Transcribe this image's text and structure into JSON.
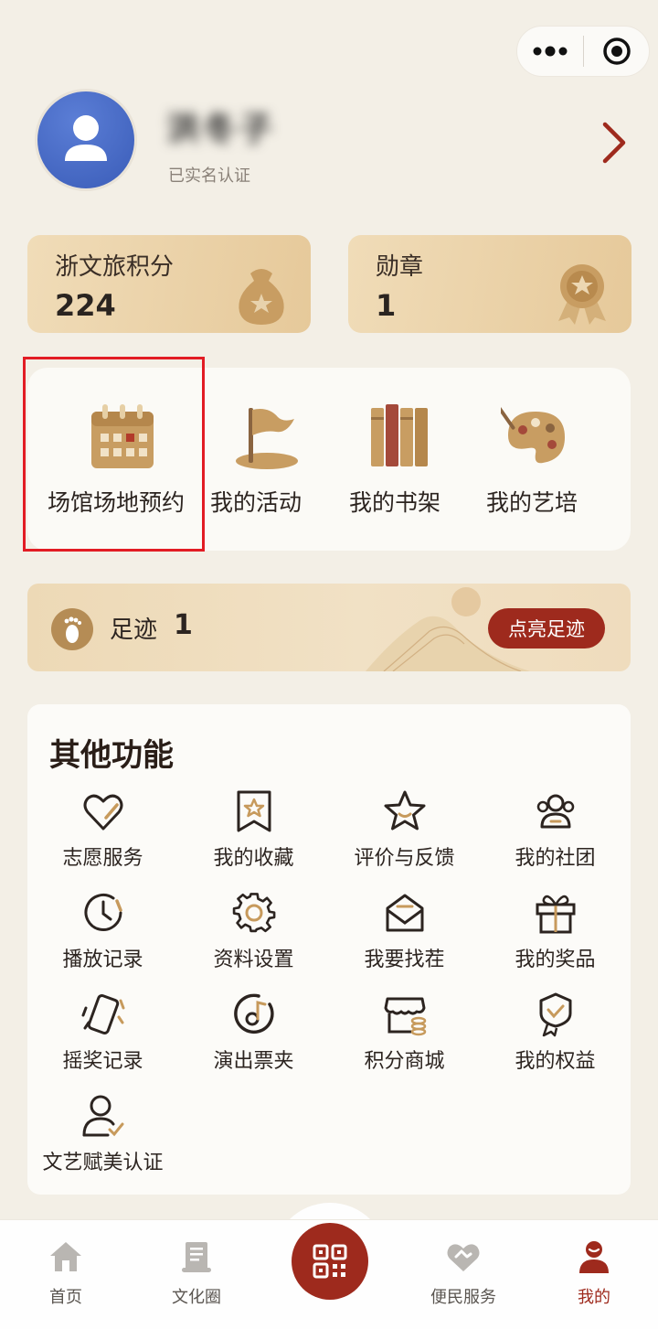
{
  "capsule": {
    "more_icon": "more-dots-icon",
    "close_icon": "target-circle-icon"
  },
  "profile": {
    "name": "洪冬子",
    "status": "已实名认证"
  },
  "stats": [
    {
      "label": "浙文旅积分",
      "value": "224",
      "icon": "money-bag-icon"
    },
    {
      "label": "勋章",
      "value": "1",
      "icon": "medal-icon"
    }
  ],
  "quick": [
    {
      "label": "场馆场地预约",
      "icon": "calendar-icon"
    },
    {
      "label": "我的活动",
      "icon": "flag-icon"
    },
    {
      "label": "我的书架",
      "icon": "books-icon"
    },
    {
      "label": "我的艺培",
      "icon": "palette-icon"
    }
  ],
  "footprint": {
    "label": "足迹",
    "count": "1",
    "button": "点亮足迹"
  },
  "other": {
    "title": "其他功能",
    "items": [
      {
        "label": "志愿服务",
        "icon": "heart-icon"
      },
      {
        "label": "我的收藏",
        "icon": "bookmark-star-icon"
      },
      {
        "label": "评价与反馈",
        "icon": "star-icon"
      },
      {
        "label": "我的社团",
        "icon": "group-icon"
      },
      {
        "label": "播放记录",
        "icon": "clock-icon"
      },
      {
        "label": "资料设置",
        "icon": "gear-icon"
      },
      {
        "label": "我要找茬",
        "icon": "mail-icon"
      },
      {
        "label": "我的奖品",
        "icon": "gift-icon"
      },
      {
        "label": "摇奖记录",
        "icon": "shake-phone-icon"
      },
      {
        "label": "演出票夹",
        "icon": "music-note-icon"
      },
      {
        "label": "积分商城",
        "icon": "store-icon"
      },
      {
        "label": "我的权益",
        "icon": "badge-icon"
      },
      {
        "label": "文艺赋美认证",
        "icon": "user-check-icon"
      }
    ]
  },
  "nav": [
    {
      "label": "首页",
      "icon": "home-icon"
    },
    {
      "label": "文化圈",
      "icon": "scroll-icon"
    },
    {
      "label": "便民服务",
      "icon": "handshake-icon"
    },
    {
      "label": "我的",
      "icon": "profile-icon"
    }
  ],
  "colors": {
    "accent": "#9e2a1d",
    "gold": "#c79a5c",
    "background": "#f3efe6"
  }
}
